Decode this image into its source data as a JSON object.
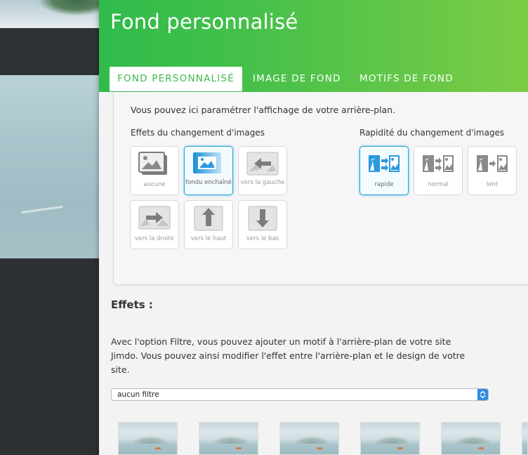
{
  "panel": {
    "title": "Fond personnalisé"
  },
  "tabs": [
    {
      "label": "FOND PERSONNALISÉ",
      "active": true
    },
    {
      "label": "IMAGE DE FOND",
      "active": false
    },
    {
      "label": "MOTIFS DE FOND",
      "active": false
    }
  ],
  "settings": {
    "intro": "Vous pouvez ici paramétrer l'affichage de votre arrière-plan.",
    "effects_heading": "Effets du changement d'images",
    "speed_heading": "Rapidité du changement d'images",
    "effect_options": [
      {
        "label": "aucune",
        "icon": "image-icon",
        "selected": false
      },
      {
        "label": "fondu enchaîné",
        "icon": "crossfade-icon",
        "selected": true
      },
      {
        "label": "vers la gauche",
        "icon": "slide-left-icon",
        "selected": false
      },
      {
        "label": "vers la droite",
        "icon": "slide-right-icon",
        "selected": false
      },
      {
        "label": "vers le haut",
        "icon": "slide-up-icon",
        "selected": false
      },
      {
        "label": "vers le bas",
        "icon": "slide-down-icon",
        "selected": false
      }
    ],
    "speed_options": [
      {
        "label": "rapide",
        "icon": "fast-icon",
        "selected": true
      },
      {
        "label": "normal",
        "icon": "normal-speed-icon",
        "selected": false
      },
      {
        "label": "lent",
        "icon": "slow-icon",
        "selected": false
      }
    ]
  },
  "effects": {
    "title": "Effets :",
    "description": "Avec l'option Filtre, vous pouvez ajouter un motif à l'arrière-plan de votre site Jimdo. Vous pouvez ainsi modifier l'effet entre l'arrière-plan et le design de votre site.",
    "filter_value": "aucun filtre"
  },
  "colors": {
    "accent": "#3fb84b",
    "selected_border": "#29a3dc",
    "select_arrow_bg": "#2f88e6"
  }
}
